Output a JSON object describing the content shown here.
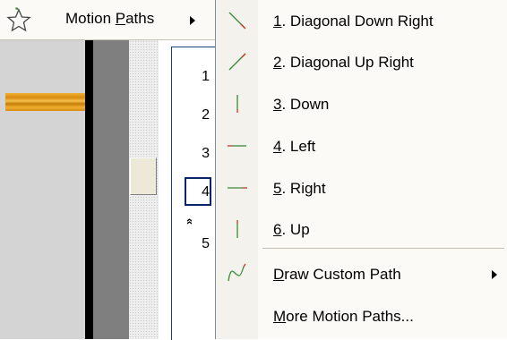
{
  "parent_menu": {
    "icon": "star-icon",
    "label_pre": "Motion ",
    "label_accel": "P",
    "label_post": "aths"
  },
  "submenu": {
    "items": [
      {
        "num": "1",
        "text": ". Diagonal Down Right",
        "icon": "diagonal-down-right-icon"
      },
      {
        "num": "2",
        "text": ". Diagonal Up Right",
        "icon": "diagonal-up-right-icon"
      },
      {
        "num": "3",
        "text": ". Down",
        "icon": "down-path-icon"
      },
      {
        "num": "4",
        "text": ". Left",
        "icon": "left-path-icon"
      },
      {
        "num": "5",
        "text": ". Right",
        "icon": "right-path-icon"
      },
      {
        "num": "6",
        "text": ". Up",
        "icon": "up-path-icon"
      }
    ],
    "draw_custom": {
      "accel": "D",
      "rest": "raw Custom Path",
      "icon": "custom-path-icon"
    },
    "more": {
      "accel": "M",
      "rest": "ore Motion Paths..."
    }
  },
  "numbers_panel": {
    "numbers": [
      "1",
      "2",
      "3",
      "4",
      "5"
    ],
    "chevron": "»"
  },
  "colors": {
    "path_green": "#3a8a3a",
    "path_red": "#c0392b",
    "orange_bar": "#e8a020",
    "menu_bg": "#fbfaf7"
  }
}
